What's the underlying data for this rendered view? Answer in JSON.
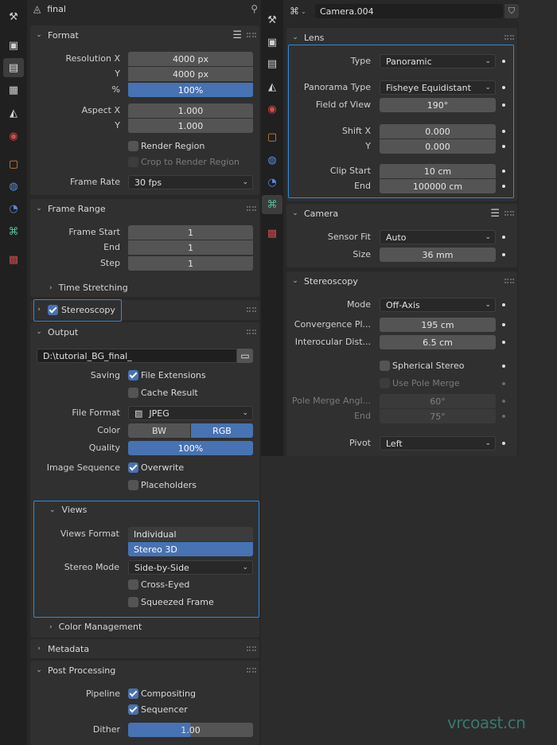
{
  "left": {
    "header_title": "final",
    "format": {
      "title": "Format",
      "resolution_x_label": "Resolution X",
      "resolution_x": "4000 px",
      "resolution_y_label": "Y",
      "resolution_y": "4000 px",
      "percent_label": "%",
      "percent": "100%",
      "aspect_x_label": "Aspect X",
      "aspect_x": "1.000",
      "aspect_y_label": "Y",
      "aspect_y": "1.000",
      "render_region": "Render Region",
      "crop_region": "Crop to Render Region",
      "frame_rate_label": "Frame Rate",
      "frame_rate": "30 fps"
    },
    "frame_range": {
      "title": "Frame Range",
      "start_label": "Frame Start",
      "start": "1",
      "end_label": "End",
      "end": "1",
      "step_label": "Step",
      "step": "1",
      "time_stretching": "Time Stretching"
    },
    "stereoscopy": {
      "title": "Stereoscopy"
    },
    "output": {
      "title": "Output",
      "path": "D:\\tutorial_BG_final_",
      "saving_label": "Saving",
      "file_extensions": "File Extensions",
      "cache_result": "Cache Result",
      "file_format_label": "File Format",
      "file_format": "JPEG",
      "color_label": "Color",
      "color_bw": "BW",
      "color_rgb": "RGB",
      "quality_label": "Quality",
      "quality": "100%",
      "image_sequence_label": "Image Sequence",
      "overwrite": "Overwrite",
      "placeholders": "Placeholders"
    },
    "views": {
      "title": "Views",
      "views_format_label": "Views Format",
      "individual": "Individual",
      "stereo_3d": "Stereo 3D",
      "stereo_mode_label": "Stereo Mode",
      "stereo_mode": "Side-by-Side",
      "cross_eyed": "Cross-Eyed",
      "squeezed_frame": "Squeezed Frame"
    },
    "color_management": "Color Management",
    "metadata": {
      "title": "Metadata"
    },
    "post_processing": {
      "title": "Post Processing",
      "pipeline_label": "Pipeline",
      "compositing": "Compositing",
      "sequencer": "Sequencer",
      "dither_label": "Dither",
      "dither": "1.00"
    }
  },
  "right": {
    "camera_name": "Camera.004",
    "lens": {
      "title": "Lens",
      "type_label": "Type",
      "type": "Panoramic",
      "panorama_type_label": "Panorama Type",
      "panorama_type": "Fisheye Equidistant",
      "fov_label": "Field of View",
      "fov": "190°",
      "shift_x_label": "Shift X",
      "shift_x": "0.000",
      "shift_y_label": "Y",
      "shift_y": "0.000",
      "clip_start_label": "Clip Start",
      "clip_start": "10 cm",
      "clip_end_label": "End",
      "clip_end": "100000 cm"
    },
    "camera": {
      "title": "Camera",
      "sensor_fit_label": "Sensor Fit",
      "sensor_fit": "Auto",
      "size_label": "Size",
      "size": "36 mm"
    },
    "stereoscopy": {
      "title": "Stereoscopy",
      "mode_label": "Mode",
      "mode": "Off-Axis",
      "convergence_label": "Convergence Pl...",
      "convergence": "195 cm",
      "interocular_label": "Interocular Dist...",
      "interocular": "6.5 cm",
      "spherical_stereo": "Spherical Stereo",
      "use_pole_merge": "Use Pole Merge",
      "pole_merge_label": "Pole Merge Angl...",
      "pole_merge": "60°",
      "pole_end_label": "End",
      "pole_end": "75°",
      "pivot_label": "Pivot",
      "pivot": "Left"
    }
  },
  "watermark": "vrcoast.cn",
  "colors": {
    "accent": "#4772b3",
    "highlight": "#2f8ae0"
  }
}
